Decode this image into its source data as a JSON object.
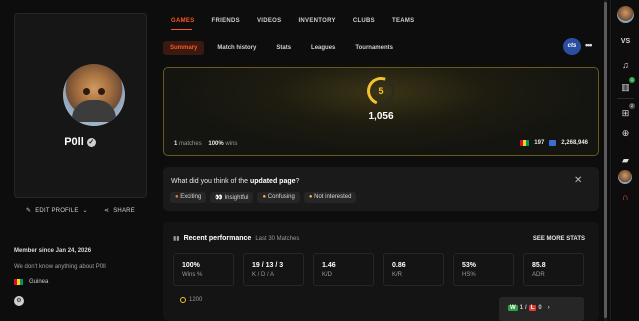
{
  "profile": {
    "name": "P0ll",
    "edit_label": "EDIT PROFILE",
    "share_label": "SHARE",
    "member_since": "Member since Jan 24, 2026",
    "about": "We don't know anything about P0ll",
    "country": "Guinea",
    "flag_colors": [
      "#ce1126",
      "#fcd116",
      "#009460"
    ]
  },
  "nav": {
    "tabs": [
      "GAMES",
      "FRIENDS",
      "VIDEOS",
      "INVENTORY",
      "CLUBS",
      "TEAMS"
    ],
    "active_tab": "GAMES",
    "subtabs": [
      "Summary",
      "Match history",
      "Stats",
      "Leagues",
      "Tournaments"
    ],
    "active_subtab": "Summary",
    "game_badge": "cts"
  },
  "rank": {
    "level": "5",
    "elo": "1,056",
    "matches": "1",
    "matches_label": "matches",
    "wins_pct": "100%",
    "wins_label": "wins",
    "country_rank": "197",
    "global_rank": "2,268,946"
  },
  "feedback": {
    "question_prefix": "What did you think of the ",
    "question_bold": "updated page",
    "question_suffix": "?",
    "options": [
      "Exciting",
      "Insightful",
      "Confusing",
      "Not interested"
    ]
  },
  "performance": {
    "title": "Recent performance",
    "subtitle": "Last 30 Matches",
    "see_more": "SEE MORE STATS",
    "stats": [
      {
        "value": "100%",
        "label": "Wins %"
      },
      {
        "value": "19 / 13 / 3",
        "label": "K / D / A"
      },
      {
        "value": "1.46",
        "label": "K/D"
      },
      {
        "value": "0.86",
        "label": "K/R"
      },
      {
        "value": "53%",
        "label": "HS%"
      },
      {
        "value": "85.8",
        "label": "ADR"
      }
    ],
    "mini_elo": "1200",
    "win_count": "1",
    "loss_count": "0",
    "wl_sep": "/"
  },
  "rail": {
    "vs_label": "VS",
    "notif_count": "1",
    "party_count": "2"
  },
  "colors": {
    "accent": "#ff5722",
    "gold": "#f2c230",
    "win": "#2ea043",
    "loss": "#e53935"
  }
}
